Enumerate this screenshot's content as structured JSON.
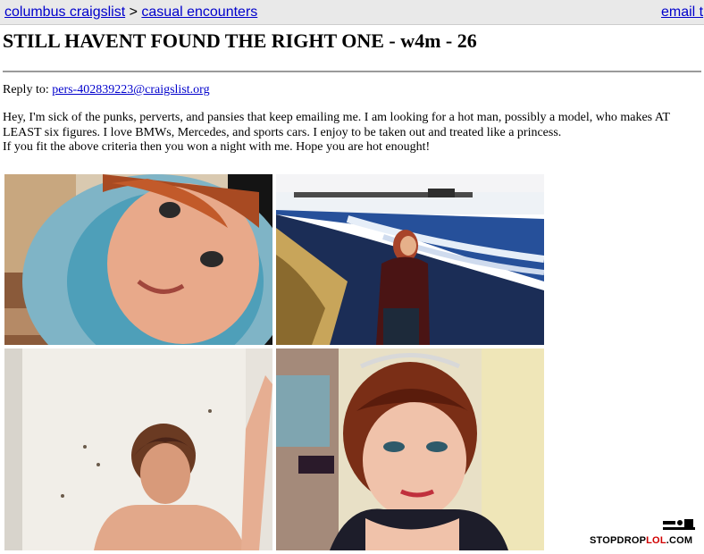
{
  "breadcrumb": {
    "site_label": "columbus craigslist",
    "separator": ">",
    "section_label": "casual encounters"
  },
  "header": {
    "email_link_label": "email t"
  },
  "posting": {
    "title": "STILL HAVENT FOUND THE RIGHT ONE - w4m - 26",
    "reply_label": "Reply to:",
    "reply_email": "pers-402839223@craigslist.org",
    "body_line_1": "Hey, I'm sick of the punks, perverts, and pansies that keep emailing me. I am looking for a hot man, possibly a model, who makes AT LEAST six figures. I love BMWs, Mercedes, and sports cars. I enjoy to be taken out and treated like a princess.",
    "body_line_2": "If you fit the above criteria then you won a night with me. Hope you are hot enought!"
  },
  "photos": [
    {
      "name": "photo-selfie-hood"
    },
    {
      "name": "photo-beach-pier"
    },
    {
      "name": "photo-bathroom-mirror"
    },
    {
      "name": "photo-tiara-selfie"
    }
  ],
  "watermark": {
    "text_part_1": "STOPDROP",
    "text_part_2": "LOL",
    "text_part_3": ".COM"
  },
  "colors": {
    "link": "#0000cc",
    "topbar_bg": "#e9e9e9",
    "watermark_red": "#d10000"
  }
}
